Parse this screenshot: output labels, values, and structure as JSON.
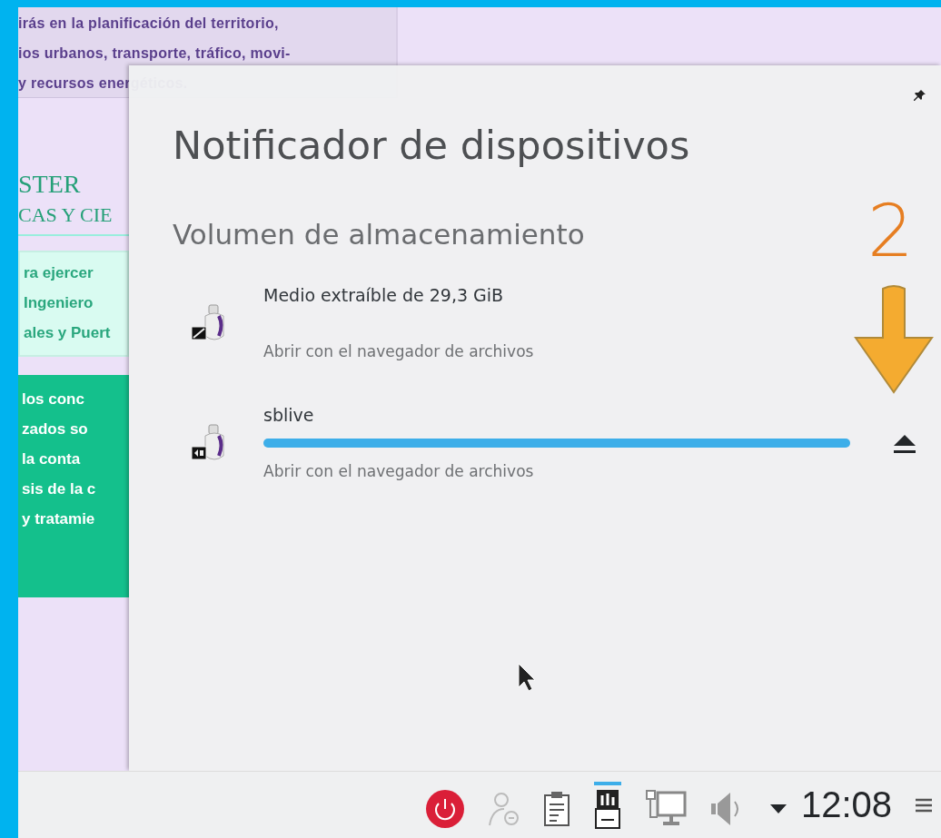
{
  "background_page": {
    "top_box_lines": [
      "irás en la planificación del territorio,",
      "ios urbanos, transporte, tráfico, movi-",
      "y recursos energéticos."
    ],
    "heading": "STER",
    "subheading": "CAS Y CIE",
    "light_box_lines": [
      "ra ejercer",
      "Ingeniero",
      "ales y Puert"
    ],
    "green_box_lines": [
      "los conc",
      "zados so",
      "la conta",
      "sis de la c",
      "y tratamie"
    ]
  },
  "popup": {
    "title": "Notificador de dispositivos",
    "section": "Volumen de almacenamiento",
    "devices": [
      {
        "name": "Medio extraíble de 29,3 GiB",
        "action": "Abrir con el navegador de archivos",
        "kind": "storage",
        "mounted": false
      },
      {
        "name": "sblive",
        "action": "Abrir con el navegador de archivos",
        "kind": "media",
        "mounted": true,
        "level": 1
      }
    ]
  },
  "annotation": {
    "number": "2"
  },
  "taskbar": {
    "tray": [
      {
        "kind": "power",
        "selected": false
      },
      {
        "kind": "user",
        "selected": false
      },
      {
        "kind": "clipboard",
        "selected": false
      },
      {
        "kind": "usb",
        "selected": true
      },
      {
        "kind": "network",
        "selected": false
      },
      {
        "kind": "volume",
        "selected": false
      },
      {
        "kind": "expand",
        "selected": false
      }
    ],
    "clock": "12:08"
  }
}
